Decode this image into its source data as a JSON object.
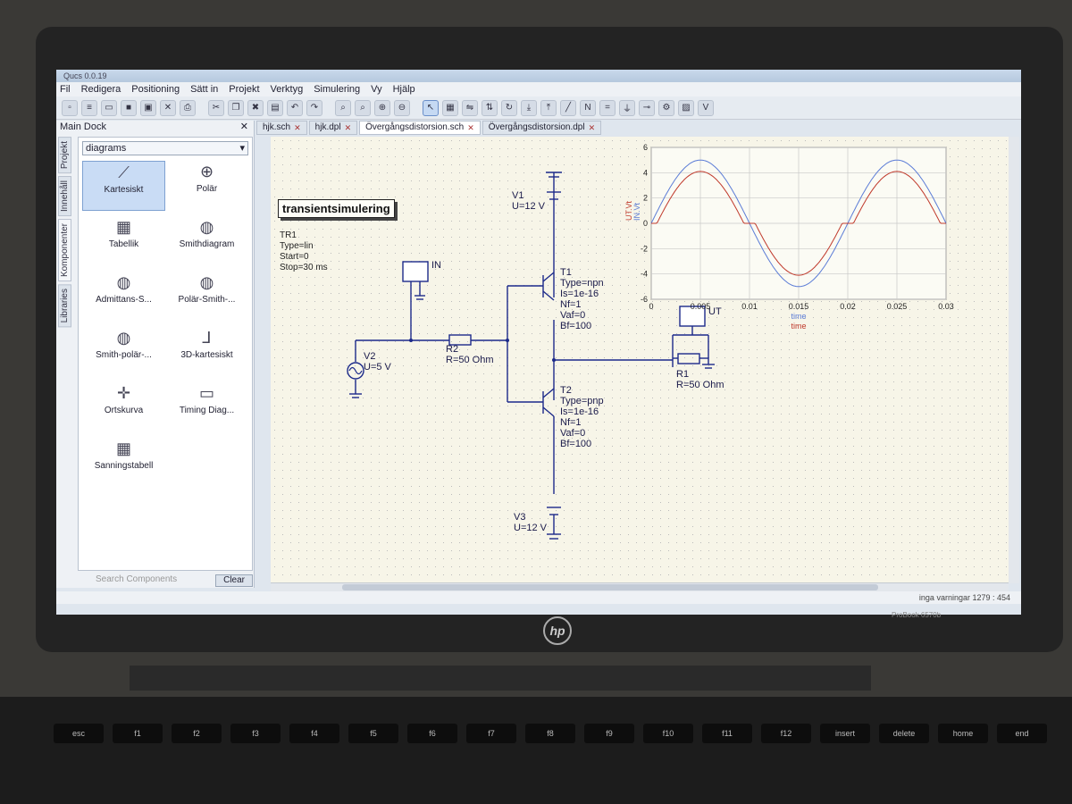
{
  "window": {
    "title": "Qucs 0.0.19"
  },
  "menu": [
    "Fil",
    "Redigera",
    "Positioning",
    "Sätt in",
    "Projekt",
    "Verktyg",
    "Simulering",
    "Vy",
    "Hjälp"
  ],
  "dock": {
    "title": "Main Dock",
    "side_tabs": [
      "Projekt",
      "Innehåll",
      "Komponenter",
      "Libraries"
    ],
    "category": "diagrams",
    "components": [
      {
        "label": "Kartesiskt",
        "icon": "cartesian-icon"
      },
      {
        "label": "Polär",
        "icon": "polar-icon"
      },
      {
        "label": "Tabellik",
        "icon": "table-icon"
      },
      {
        "label": "Smithdiagram",
        "icon": "smith-icon"
      },
      {
        "label": "Admittans-S...",
        "icon": "admittance-smith-icon"
      },
      {
        "label": "Polär-Smith-...",
        "icon": "polar-smith-icon"
      },
      {
        "label": "Smith-polär-...",
        "icon": "smith-polar-icon"
      },
      {
        "label": "3D-kartesiskt",
        "icon": "cartesian-3d-icon"
      },
      {
        "label": "Ortskurva",
        "icon": "locus-icon"
      },
      {
        "label": "Timing Diag...",
        "icon": "timing-icon"
      },
      {
        "label": "Sanningstabell",
        "icon": "truth-table-icon"
      }
    ],
    "search_placeholder": "Search Components",
    "clear_label": "Clear"
  },
  "tabs": [
    {
      "label": "hjk.sch"
    },
    {
      "label": "hjk.dpl"
    },
    {
      "label": "Övergångsdistorsion.sch",
      "active": true
    },
    {
      "label": "Övergångsdistorsion.dpl"
    }
  ],
  "schematic": {
    "simulation": {
      "title": "transientsimulering",
      "params": [
        "TR1",
        "Type=lin",
        "Start=0",
        "Stop=30 ms"
      ]
    },
    "V1": [
      "V1",
      "U=12 V"
    ],
    "V2": [
      "V2",
      "U=5 V"
    ],
    "V3": [
      "V3",
      "U=12 V"
    ],
    "probe_in": "IN",
    "probe_out": "UT",
    "R2": [
      "R2",
      "R=50 Ohm"
    ],
    "R1": [
      "R1",
      "R=50 Ohm"
    ],
    "T1": [
      "T1",
      "Type=npn",
      "Is=1e-16",
      "Nf=1",
      "Vaf=0",
      "Bf=100"
    ],
    "T2": [
      "T2",
      "Type=pnp",
      "Is=1e-16",
      "Nf=1",
      "Vaf=0",
      "Bf=100"
    ]
  },
  "chart_data": {
    "type": "line",
    "xlabel": "time",
    "xlabel2": "time",
    "ylabels": [
      "UT.Vt",
      "IN.Vt"
    ],
    "xlim": [
      0,
      0.03
    ],
    "ylim": [
      -6,
      6
    ],
    "x_ticks": [
      "0",
      "0.005",
      "0.01",
      "0.015",
      "0.02",
      "0.025",
      "0.03"
    ],
    "y_ticks": [
      "6",
      "4",
      "2",
      "0",
      "-2",
      "-4",
      "-6"
    ],
    "grid": true,
    "series": [
      {
        "name": "IN.Vt",
        "color": "#5a7bd6",
        "amplitude": 5,
        "frequency_hz": 50,
        "dead_zone": 0
      },
      {
        "name": "UT.Vt",
        "color": "#c0392b",
        "amplitude": 5,
        "frequency_hz": 50,
        "dead_zone": 0.9
      }
    ]
  },
  "status": {
    "text": "inga varningar 1279 : 454"
  },
  "laptop": {
    "brand": "hp",
    "model": "ProBook 6570b"
  },
  "keyboard": [
    "esc",
    "f1",
    "f2",
    "f3",
    "f4",
    "f5",
    "f6",
    "f7",
    "f8",
    "f9",
    "f10",
    "f11",
    "f12",
    "insert",
    "delete",
    "home",
    "end"
  ]
}
